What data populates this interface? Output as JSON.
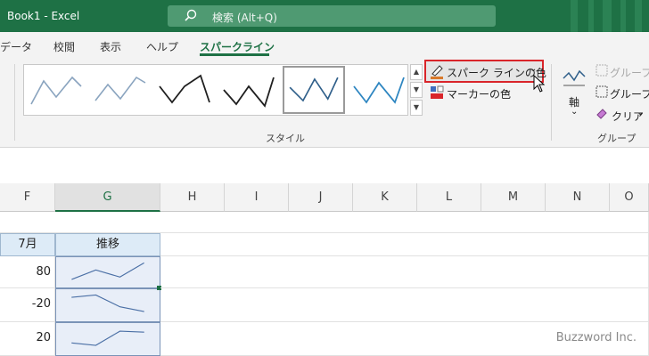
{
  "titlebar": {
    "title": "Book1  -  Excel",
    "search_placeholder": "検索 (Alt+Q)"
  },
  "tabs": [
    {
      "label": "データ",
      "active": false
    },
    {
      "label": "校閲",
      "active": false
    },
    {
      "label": "表示",
      "active": false
    },
    {
      "label": "ヘルプ",
      "active": false
    },
    {
      "label": "スパークライン",
      "active": true
    }
  ],
  "ribbon": {
    "style_group_label": "スタイル",
    "sparkline_color_label": "スパーク ラインの色",
    "marker_color_label": "マーカーの色",
    "axis_label": "軸",
    "group_label": "グループ",
    "group_cmd_label": "グループ化",
    "ungroup_label": "グループ解除",
    "clear_label": "クリア",
    "group_section_label": "グループ",
    "gallery_colors": [
      "#8aa4bf",
      "#8aa4bf",
      "#1f1f1f",
      "#1f1f1f",
      "#2f5f8a",
      "#2e86c1"
    ],
    "gallery_selected_index": 4
  },
  "sheet": {
    "columns": [
      "F",
      "G",
      "H",
      "I",
      "J",
      "K",
      "L",
      "M",
      "N",
      "O"
    ],
    "selected_column": "G",
    "header_row": {
      "F": "7月",
      "G": "推移"
    },
    "rows": [
      {
        "F": "80",
        "spark": [
          10,
          30,
          15,
          45
        ]
      },
      {
        "F": "-20",
        "spark": [
          40,
          45,
          20,
          10
        ]
      },
      {
        "F": "20",
        "spark": [
          15,
          10,
          40,
          38
        ]
      }
    ],
    "accent": "#1e7145"
  },
  "watermark": "Buzzword Inc."
}
